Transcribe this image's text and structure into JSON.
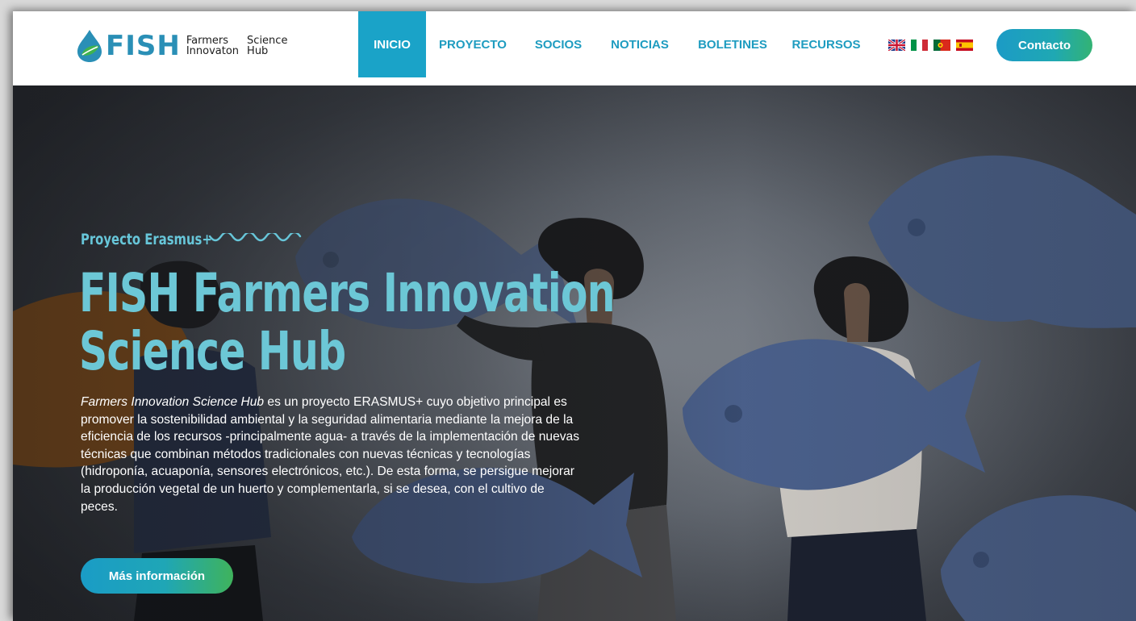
{
  "brand": {
    "wordmark": "FISH",
    "tagline_1": "Farmers",
    "tagline_2": "Science",
    "tagline_3": "Innovaton",
    "tagline_4": "Hub",
    "colors": {
      "primary": "#1aa3c8",
      "wordmark": "#2a8fb6",
      "leaf": "#3fb34f",
      "accent_title": "#6cc7d6"
    }
  },
  "nav": {
    "items": [
      {
        "label": "INICIO",
        "active": true
      },
      {
        "label": "PROYECTO",
        "active": false
      },
      {
        "label": "SOCIOS",
        "active": false
      },
      {
        "label": "NOTICIAS",
        "active": false
      },
      {
        "label": "BOLETINES",
        "active": false
      },
      {
        "label": "RECURSOS",
        "active": false
      }
    ],
    "languages": [
      "uk-flag-icon",
      "italy-flag-icon",
      "portugal-flag-icon",
      "spain-flag-icon"
    ],
    "contact_label": "Contacto"
  },
  "hero": {
    "eyebrow": "Proyecto Erasmus+",
    "title_line_1": "FISH Farmers Innovation",
    "title_line_2": "Science Hub",
    "desc_em": "Farmers Innovation Science Hub",
    "desc_rest": " es un proyecto ERASMUS+ cuyo objetivo principal es promover la sostenibilidad ambiental y la seguridad alimentaria mediante la mejora de la eficiencia de los recursos -principalmente agua- a través de la implementación de nuevas técnicas que combinan métodos tradicionales con nuevas técnicas y tecnologías (hidroponía, acuaponía, sensores electrónicos, etc.). De esta forma, se persigue mejorar la producción vegetal de un huerto y complementarla, si se desea, con el cultivo de peces.",
    "cta_label": "Más información"
  }
}
